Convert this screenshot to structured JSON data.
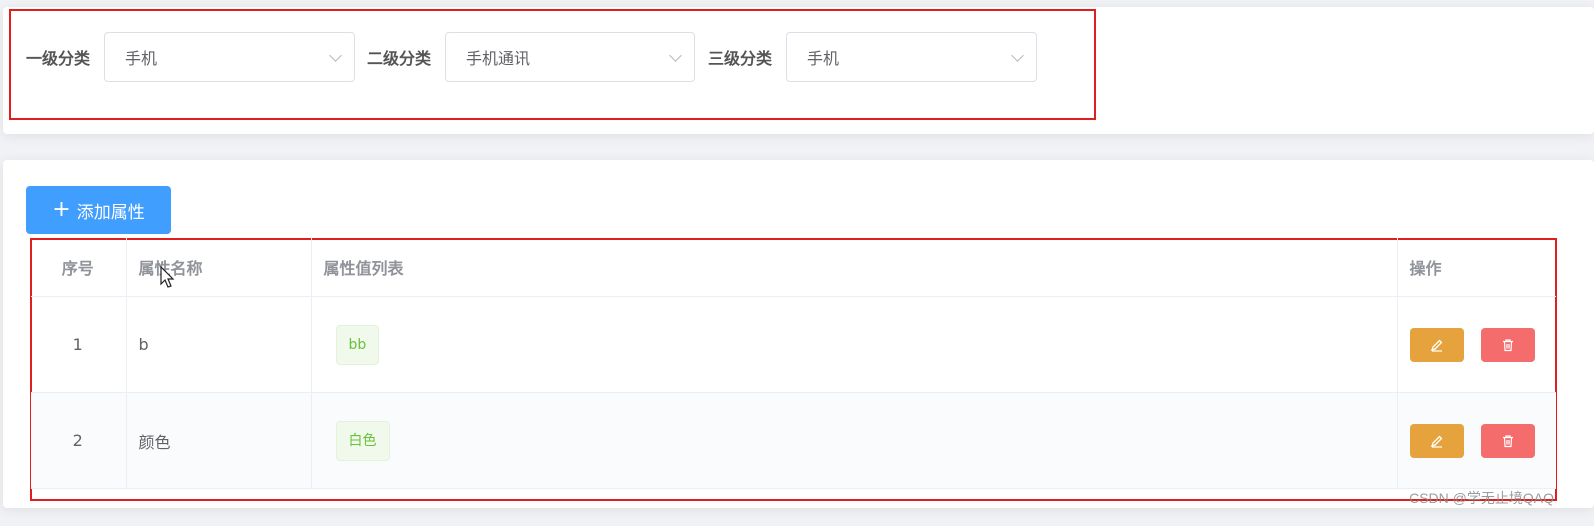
{
  "filters": [
    {
      "label": "一级分类",
      "value": "手机"
    },
    {
      "label": "二级分类",
      "value": "手机通讯"
    },
    {
      "label": "三级分类",
      "value": "手机"
    }
  ],
  "add_button": {
    "icon": "plus-icon",
    "label": "添加属性"
  },
  "table": {
    "headers": [
      "序号",
      "属性名称",
      "属性值列表",
      "操作"
    ],
    "rows": [
      {
        "index": "1",
        "name": "b",
        "values": [
          "bb"
        ]
      },
      {
        "index": "2",
        "name": "颜色",
        "values": [
          "白色"
        ]
      }
    ]
  },
  "actions": {
    "edit_icon": "pencil-icon",
    "delete_icon": "trash-icon"
  },
  "watermark": "CSDN @学无止境QAQ",
  "colors": {
    "primary": "#409eff",
    "warning": "#e6a23c",
    "danger": "#f56c6c",
    "highlight_box": "#e01e1e"
  }
}
